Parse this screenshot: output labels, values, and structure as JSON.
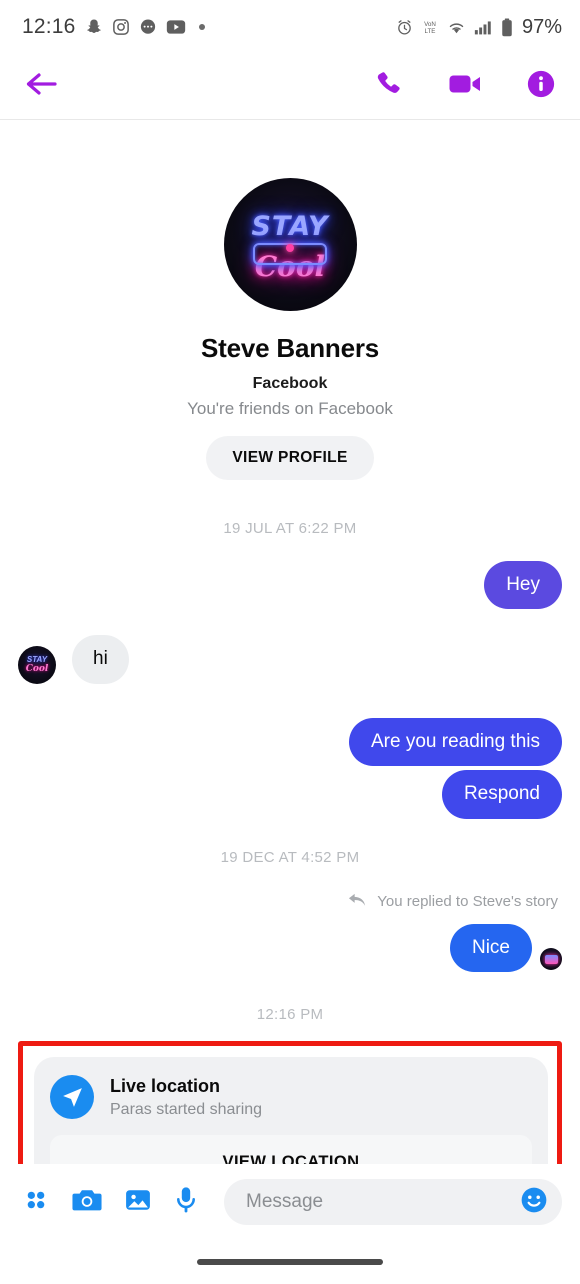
{
  "statusbar": {
    "time": "12:16",
    "battery_percent": "97%",
    "left_icons": [
      "snapchat-icon",
      "instagram-icon",
      "messenger-chat-icon",
      "youtube-icon",
      "overflow-dot-icon"
    ],
    "right_icons": [
      "alarm-clock-icon",
      "volte-icon",
      "wifi-icon",
      "signal-bars-icon",
      "battery-icon"
    ]
  },
  "header": {
    "back_icon": "back-arrow-icon",
    "accent_color": "#A21CE0",
    "actions": [
      {
        "name": "audio-call-button",
        "icon": "phone-icon"
      },
      {
        "name": "video-call-button",
        "icon": "video-camera-icon"
      },
      {
        "name": "conversation-info-button",
        "icon": "info-circle-icon"
      }
    ]
  },
  "profile": {
    "avatar_alt": "stay-cool-neon-avatar",
    "avatar_text_top": "STAY",
    "avatar_text_bottom": "Cool",
    "name": "Steve Banners",
    "platform": "Facebook",
    "relationship": "You're friends on Facebook",
    "view_profile_label": "VIEW PROFILE"
  },
  "conversation": {
    "timestamp_1": "19 JUL AT 6:22 PM",
    "timestamp_2": "19 DEC AT 4:52 PM",
    "timestamp_3": "12:16 PM",
    "reply_context": "You replied to Steve's story",
    "messages": [
      {
        "text": "Hey",
        "direction": "out",
        "color": "#5B4AE0"
      },
      {
        "text": "hi",
        "direction": "in",
        "color": "#ECEEF0"
      },
      {
        "text": "Are you reading this",
        "direction": "out",
        "color": "#4048EC"
      },
      {
        "text": "Respond",
        "direction": "out",
        "color": "#4048EC"
      },
      {
        "text": "Nice",
        "direction": "out",
        "color": "#2566F0"
      }
    ]
  },
  "location_card": {
    "highlight_color": "#EE1B12",
    "icon": "location-arrow-icon",
    "title": "Live location",
    "subtitle": "Paras started sharing",
    "button_label": "VIEW LOCATION",
    "delivery_status_icon": "check-circle-icon"
  },
  "composer": {
    "accent_color": "#1A8CF0",
    "placeholder": "Message",
    "value": "",
    "tools": [
      {
        "name": "apps-grid-button",
        "icon": "four-dots-icon"
      },
      {
        "name": "camera-button",
        "icon": "camera-icon"
      },
      {
        "name": "gallery-button",
        "icon": "image-icon"
      },
      {
        "name": "voice-button",
        "icon": "microphone-icon"
      }
    ],
    "emoji_icon": "smiley-face-icon"
  },
  "navbar": {
    "gesture_pill": "home-gesture-pill"
  }
}
